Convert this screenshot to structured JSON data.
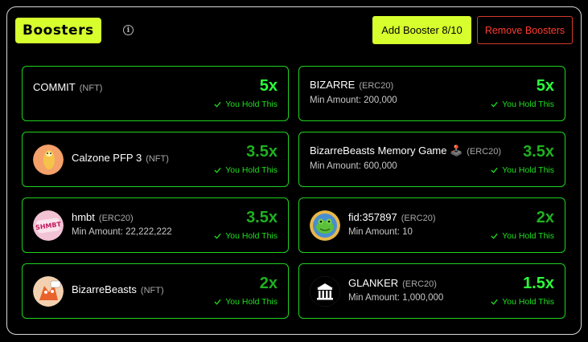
{
  "header": {
    "title": "Boosters",
    "info_icon": "info-icon",
    "add_button": "Add Booster 8/10",
    "remove_button": "Remove Boosters"
  },
  "colors": {
    "accent": "#d7ff2e",
    "border_green": "#1fd21f",
    "mult_bright": "#2bff3a",
    "mult_dim": "#1fb11f",
    "danger": "#ff3b30"
  },
  "boosters": [
    {
      "name": "COMMIT",
      "type": "(NFT)",
      "min": "",
      "multiplier": "5x",
      "hold": "You Hold This",
      "icon": "",
      "bright": true
    },
    {
      "name": "BIZARRE",
      "type": "(ERC20)",
      "min": "Min Amount: 200,000",
      "multiplier": "5x",
      "hold": "You Hold This",
      "icon": "",
      "bright": true
    },
    {
      "name": "Calzone PFP 3",
      "type": "(NFT)",
      "min": "",
      "multiplier": "3.5x",
      "hold": "You Hold This",
      "icon": "calzone-avatar-icon",
      "bright": false
    },
    {
      "name": "BizarreBeasts Memory Game 🕹️",
      "type": "(ERC20)",
      "min": "Min Amount: 600,000",
      "multiplier": "3.5x",
      "hold": "You Hold This",
      "icon": "",
      "bright": false
    },
    {
      "name": "hmbt",
      "type": "(ERC20)",
      "min": "Min Amount: 22,222,222",
      "multiplier": "3.5x",
      "hold": "You Hold This",
      "icon": "hmbt-sticker-icon",
      "bright": false
    },
    {
      "name": "fid:357897",
      "type": "(ERC20)",
      "min": "Min Amount: 10",
      "multiplier": "2x",
      "hold": "You Hold This",
      "icon": "frog-avatar-icon",
      "bright": false
    },
    {
      "name": "BizarreBeasts",
      "type": "(NFT)",
      "min": "",
      "multiplier": "2x",
      "hold": "You Hold This",
      "icon": "beast-avatar-icon",
      "bright": false
    },
    {
      "name": "GLANKER",
      "type": "(ERC20)",
      "min": "Min Amount: 1,000,000",
      "multiplier": "1.5x",
      "hold": "You Hold This",
      "icon": "bank-building-icon",
      "bright": true
    }
  ]
}
